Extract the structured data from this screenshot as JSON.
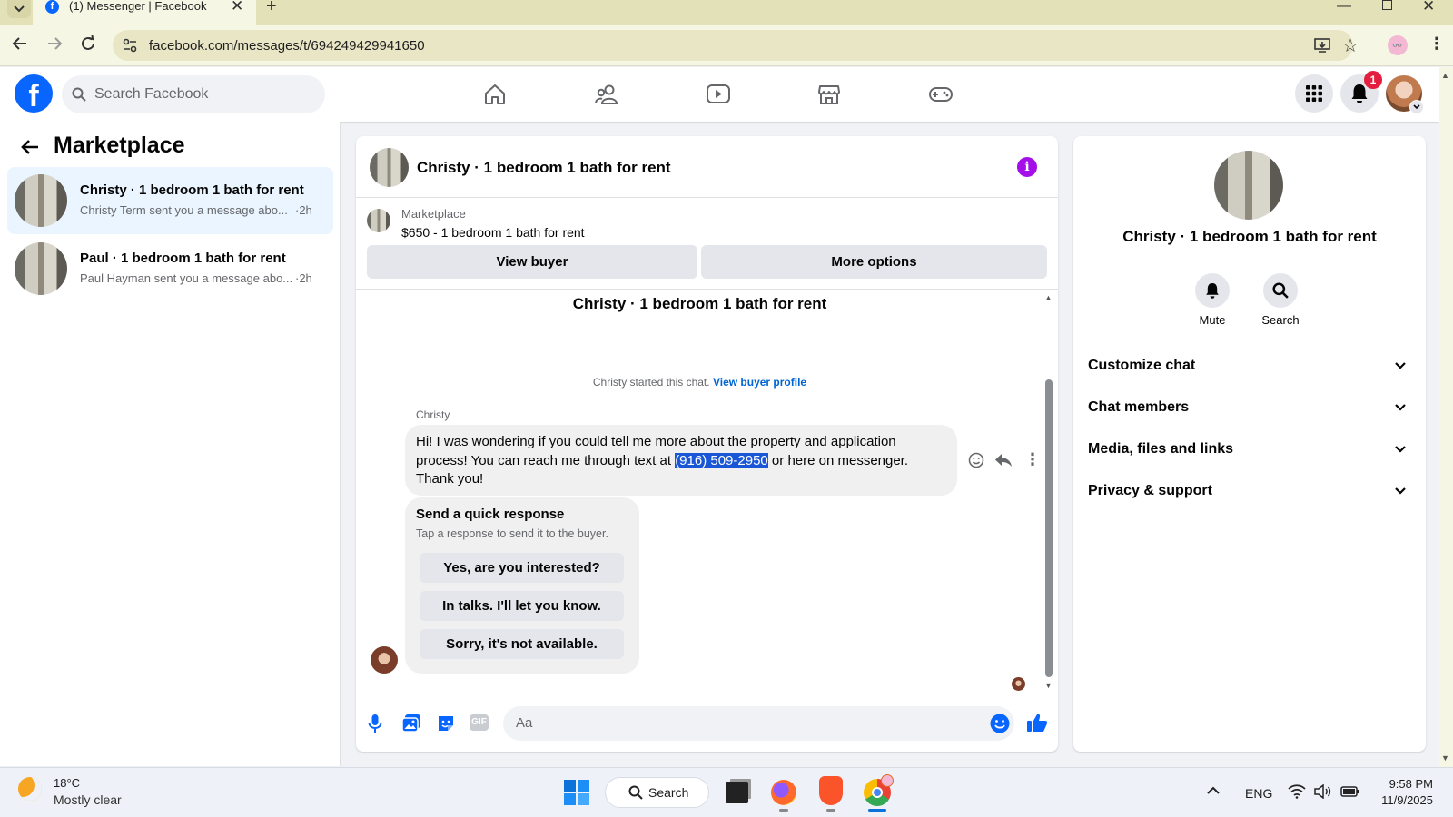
{
  "browser": {
    "tab_title": "(1) Messenger | Facebook",
    "url": "facebook.com/messages/t/694249429941650"
  },
  "header": {
    "search_placeholder": "Search Facebook",
    "notification_count": "1",
    "nav_icons": [
      "home-icon",
      "friends-icon",
      "video-icon",
      "marketplace-icon",
      "gaming-icon"
    ],
    "brand_color": "#0866ff"
  },
  "sidebar": {
    "title": "Marketplace",
    "conversations": [
      {
        "title": "Christy · 1 bedroom 1 bath for rent",
        "preview": "Christy Term sent you a message abo...",
        "time": "·2h",
        "selected": true
      },
      {
        "title": "Paul · 1 bedroom 1 bath for rent",
        "preview": "Paul Hayman sent you a message abo...",
        "time": "·2h",
        "selected": false
      }
    ]
  },
  "chat": {
    "title": "Christy · 1 bedroom 1 bath for rent",
    "listing_source": "Marketplace",
    "listing_line": "$650 - 1 bedroom 1 bath for rent",
    "view_buyer": "View buyer",
    "more_options": "More options",
    "thread_title": "Christy · 1 bedroom 1 bath for rent",
    "started_text": "Christy started this chat.",
    "view_buyer_profile": "View buyer profile",
    "sender_name": "Christy",
    "message_part1": "Hi! I was wondering if you could tell me more about the property and application process! You can reach me through text at ",
    "message_phone": "(916) 509-2950",
    "message_part2": " or here on messenger. Thank you!",
    "quick_response_title": "Send a quick response",
    "quick_response_sub": "Tap a response to send it to the buyer.",
    "quick_responses": [
      "Yes, are you interested?",
      "In talks. I'll let you know.",
      "Sorry, it's not available."
    ],
    "composer_placeholder": "Aa"
  },
  "details": {
    "title": "Christy · 1 bedroom 1 bath for rent",
    "mute": "Mute",
    "search": "Search",
    "sections": [
      "Customize chat",
      "Chat members",
      "Media, files and links",
      "Privacy & support"
    ]
  },
  "taskbar": {
    "temperature": "18°C",
    "weather": "Mostly clear",
    "search": "Search",
    "language": "ENG",
    "time": "9:58 PM",
    "date": "11/9/2025"
  }
}
